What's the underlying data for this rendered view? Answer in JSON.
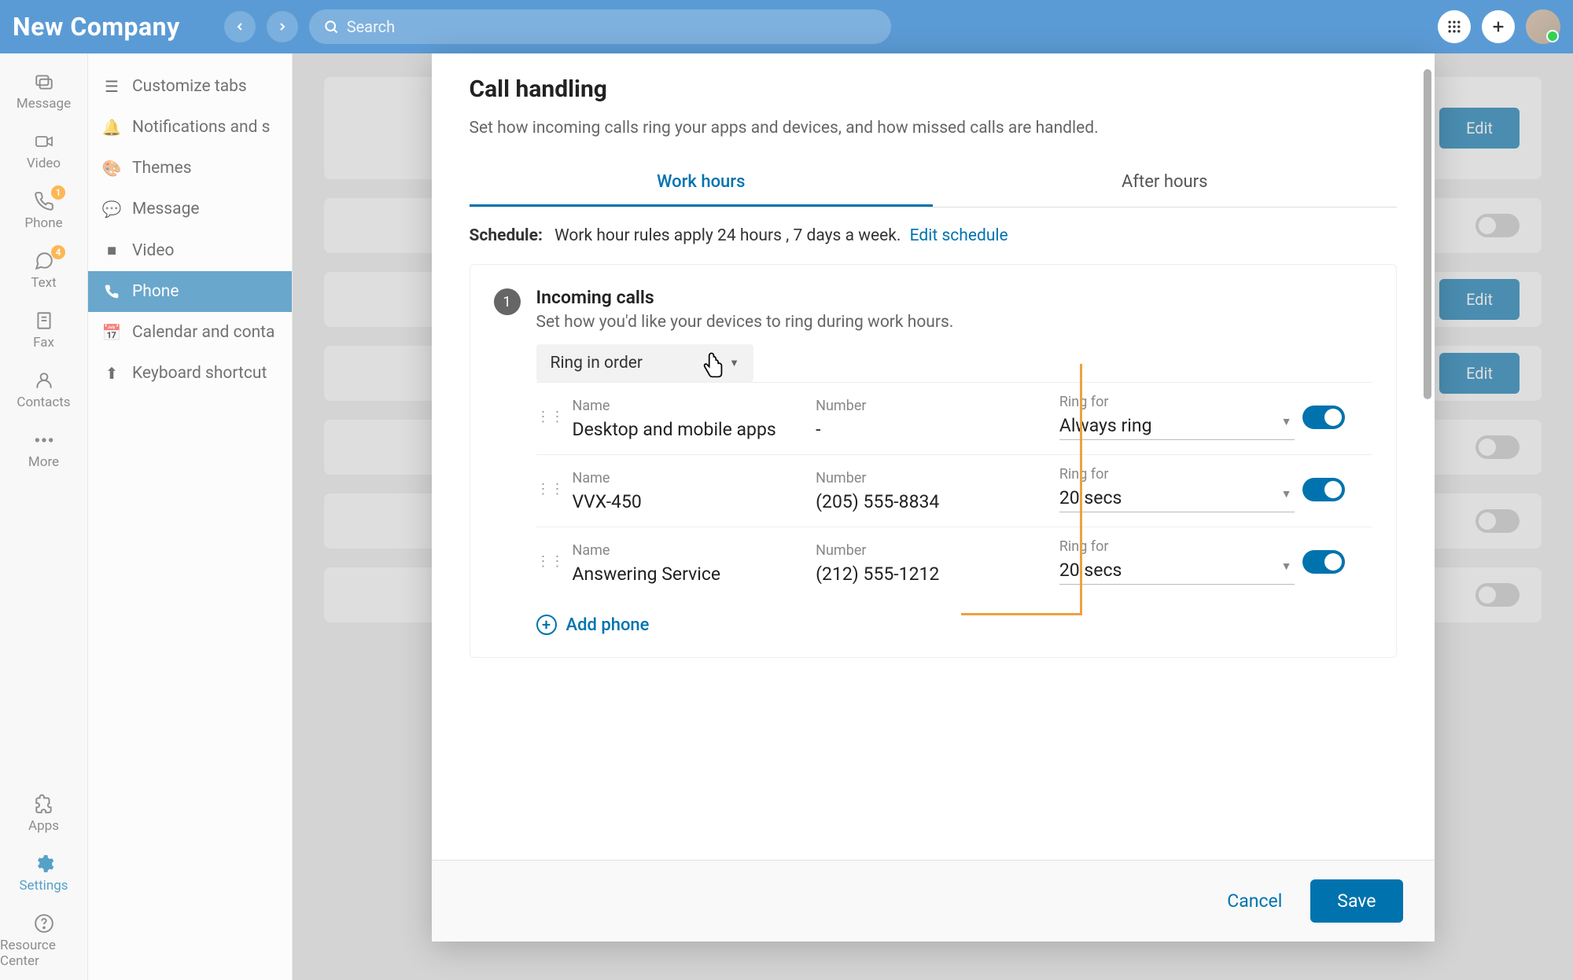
{
  "topbar": {
    "company": "New Company",
    "search_placeholder": "Search"
  },
  "leftrail": [
    {
      "label": "Message",
      "icon": "chat"
    },
    {
      "label": "Video",
      "icon": "video"
    },
    {
      "label": "Phone",
      "icon": "phone",
      "badge": "1"
    },
    {
      "label": "Text",
      "icon": "text",
      "badge": "4"
    },
    {
      "label": "Fax",
      "icon": "fax"
    },
    {
      "label": "Contacts",
      "icon": "contacts"
    },
    {
      "label": "More",
      "icon": "more"
    }
  ],
  "leftrail_bottom": [
    {
      "label": "Apps",
      "icon": "puzzle"
    },
    {
      "label": "Settings",
      "icon": "gear",
      "active": true
    },
    {
      "label": "Resource Center",
      "icon": "help"
    }
  ],
  "settings_list": [
    {
      "label": "Customize tabs",
      "icon": "tabs"
    },
    {
      "label": "Notifications and s",
      "icon": "bell"
    },
    {
      "label": "Themes",
      "icon": "palette"
    },
    {
      "label": "Message",
      "icon": "msg"
    },
    {
      "label": "Video",
      "icon": "vid"
    },
    {
      "label": "Phone",
      "icon": "phone",
      "active": true
    },
    {
      "label": "Calendar and conta",
      "icon": "calendar"
    },
    {
      "label": "Keyboard shortcut",
      "icon": "keyboard"
    }
  ],
  "modal": {
    "title": "Call handling",
    "description": "Set how incoming calls ring your apps and devices, and how missed calls are handled.",
    "tabs": {
      "work": "Work hours",
      "after": "After hours"
    },
    "schedule_label": "Schedule:",
    "schedule_text": "Work hour rules apply 24 hours , 7 days a week.",
    "edit_schedule": "Edit schedule",
    "section1": {
      "step": "1",
      "title": "Incoming calls",
      "sub": "Set how you'd like your devices to ring during work hours.",
      "ring_mode": "Ring in order",
      "headers": {
        "name": "Name",
        "number": "Number",
        "ring_for": "Ring for"
      },
      "devices": [
        {
          "name": "Desktop and mobile apps",
          "number": "-",
          "ring_for": "Always ring"
        },
        {
          "name": "VVX-450",
          "number": "(205) 555-8834",
          "ring_for": "20 secs"
        },
        {
          "name": "Answering Service",
          "number": "(212) 555-1212",
          "ring_for": "20 secs"
        }
      ],
      "add_phone": "Add phone"
    },
    "cancel": "Cancel",
    "save": "Save"
  },
  "bg": {
    "edit": "Edit"
  }
}
